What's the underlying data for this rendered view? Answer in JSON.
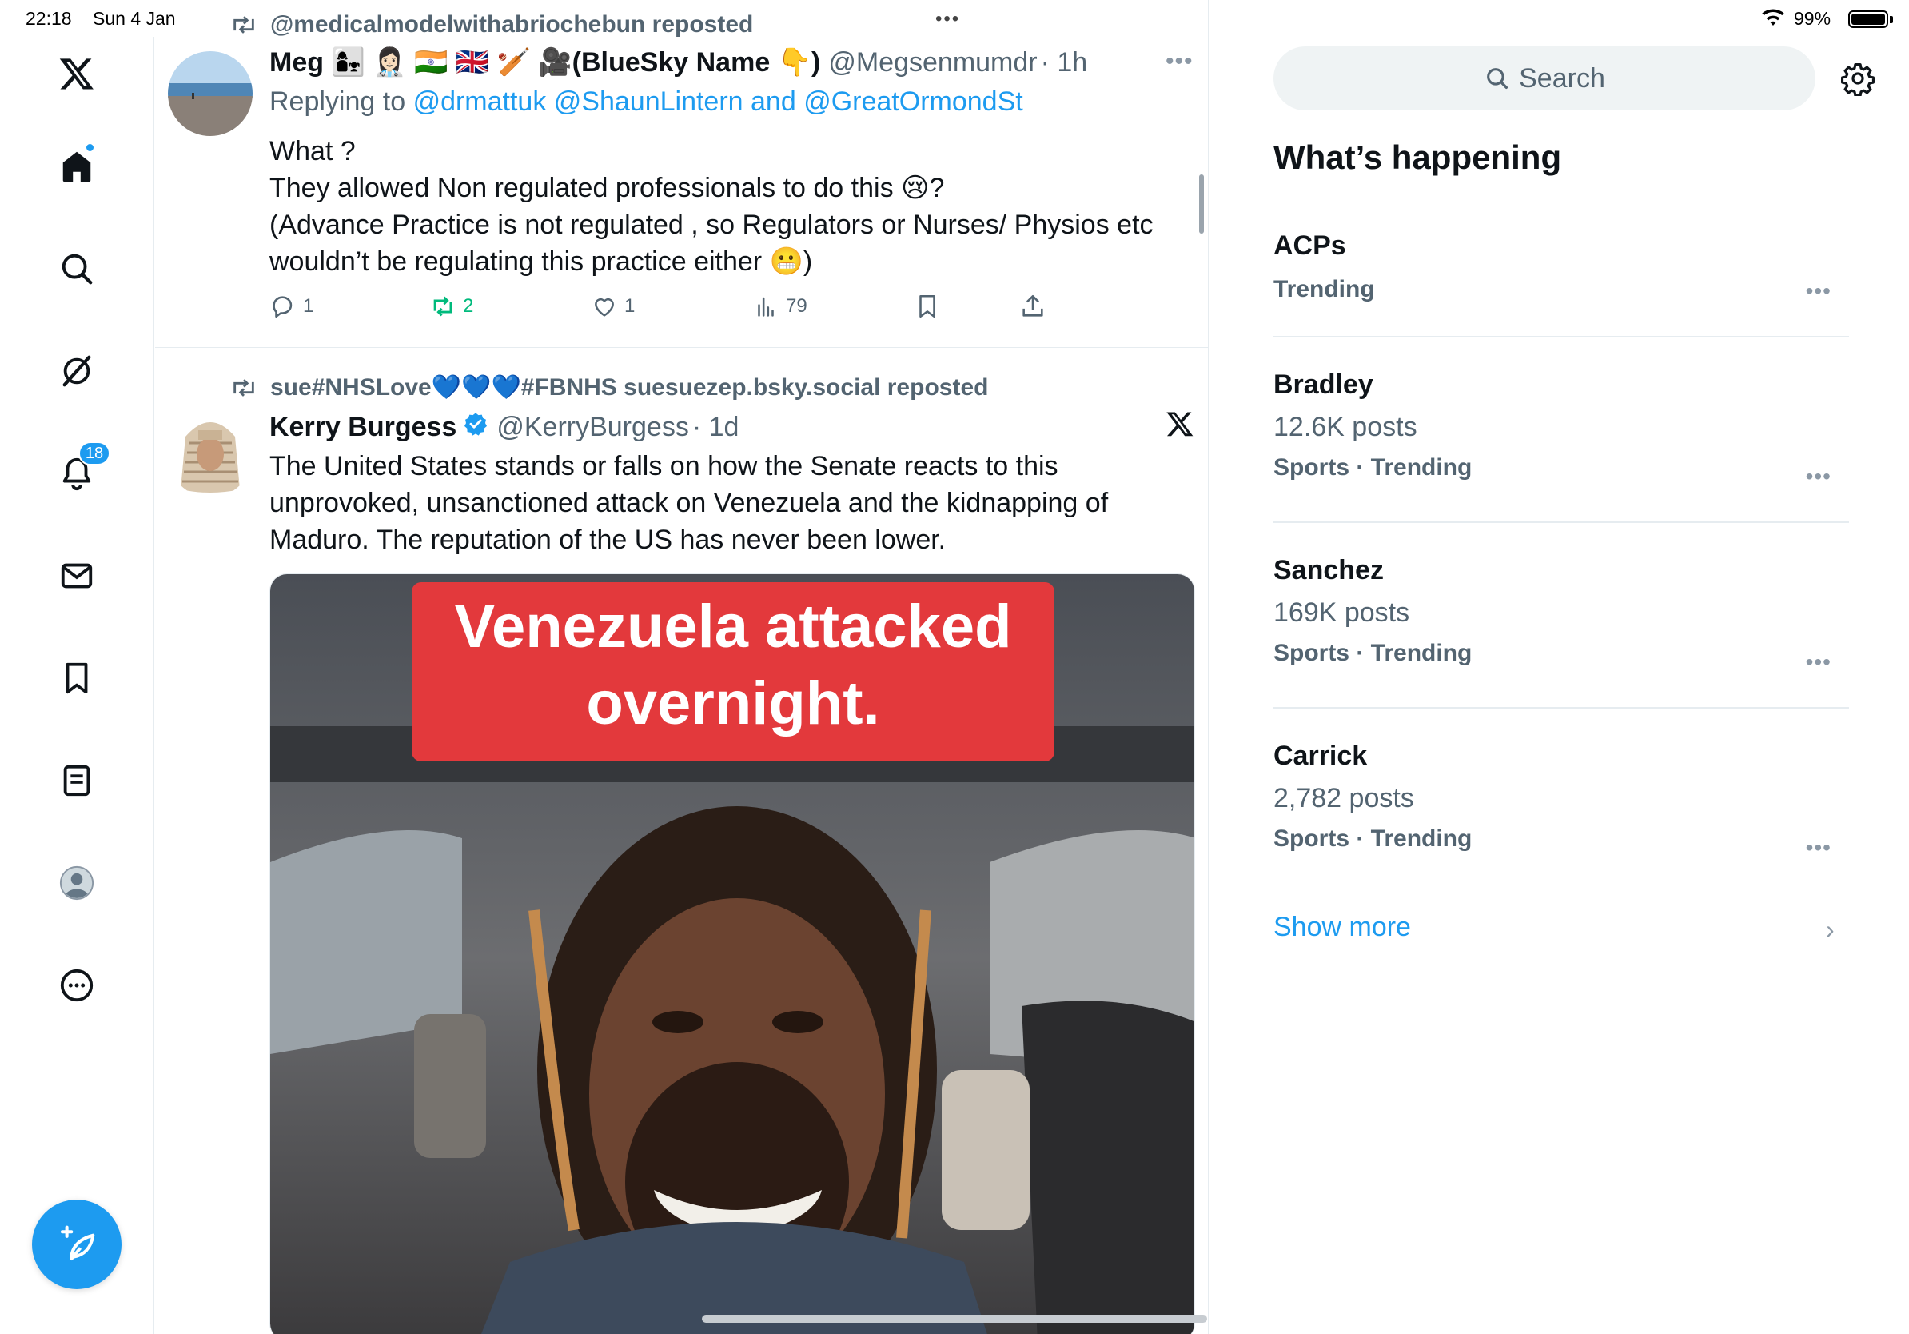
{
  "status_bar": {
    "time": "22:18",
    "date": "Sun 4 Jan",
    "battery_percent": "99%",
    "battery_level": 0.99
  },
  "nav": {
    "notification_count": "18",
    "items": [
      "home",
      "explore",
      "grok",
      "notifications",
      "messages",
      "bookmarks",
      "lists",
      "profile",
      "more"
    ]
  },
  "timeline": {
    "tweets": [
      {
        "repost_by": "@medicalmodelwithabriochebun reposted",
        "name": "Meg 👩‍👧 👩🏻‍⚕️ 🇮🇳 🇬🇧 🏏 🎥(BlueSky Name 👇)",
        "handle": "@Megsenmumdr",
        "time": "· 1h",
        "replying_label": "Replying to",
        "replying_to": "@drmattuk @ShaunLintern and @GreatOrmondSt",
        "text": "What ?\nThey allowed Non regulated professionals to do this 😢?\n(Advance Practice is not regulated , so Regulators or Nurses/ Physios etc\nwouldn’t be regulating this practice either 😬)",
        "replies": "1",
        "reposts": "2",
        "likes": "1",
        "views": "79"
      },
      {
        "repost_by": "sue#NHSLove💙💙💙#FBNHS suesuezep.bsky.social reposted",
        "name": "Kerry Burgess",
        "handle": "@KerryBurgess",
        "time": "· 1d",
        "text": "The United States stands or falls on how the Senate reacts to this\nunprovoked, unsanctioned attack on Venezuela and the kidnapping of\nMaduro. The reputation of the US has never been lower.",
        "media_caption": "Venezuela attacked\novernight."
      }
    ]
  },
  "sidebar": {
    "search_placeholder": "Search",
    "heading": "What’s happening",
    "trends": [
      {
        "title": "ACPs",
        "posts": "",
        "category": "Trending"
      },
      {
        "title": "Bradley",
        "posts": "12.6K posts",
        "category": "Sports · Trending"
      },
      {
        "title": "Sanchez",
        "posts": "169K posts",
        "category": "Sports · Trending"
      },
      {
        "title": "Carrick",
        "posts": "2,782 posts",
        "category": "Sports · Trending"
      }
    ],
    "show_more": "Show more"
  },
  "colors": {
    "accent": "#1d9bf0",
    "text_secondary": "#536471",
    "repost_green": "#00ba7c",
    "caption_red": "#e3393c"
  }
}
